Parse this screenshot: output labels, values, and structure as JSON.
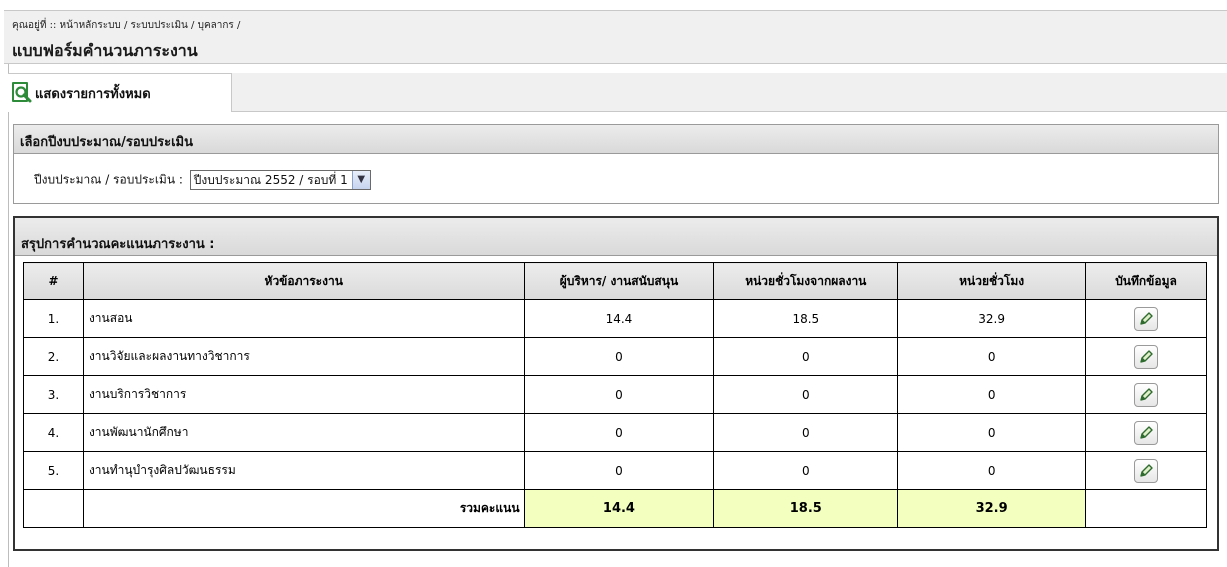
{
  "header": {
    "breadcrumb": "คุณอยู่ที่ :: หน้าหลักระบบ / ระบบประเมิน / บุคลากร /",
    "title": "แบบฟอร์มคำนวนภาระงาน"
  },
  "tabs": [
    {
      "label": "แสดงรายการทั้งหมด",
      "icon": "magnifier-document-icon"
    }
  ],
  "budget_panel": {
    "heading": "เลือกปีงบประมาณ/รอบประเมิน",
    "field_label": "ปีงบประมาณ / รอบประเมิน :",
    "selected": "ปีงบประมาณ 2552 / รอบที่ 1"
  },
  "summary_panel": {
    "heading": "สรุปการคำนวณคะแนนภาระงาน :",
    "columns": [
      "#",
      "หัวข้อภาระงาน",
      "ผู้บริหาร/ งานสนับสนุน",
      "หน่วยชั่วโมงจากผลงาน",
      "หน่วยชั่วโมง",
      "บันทึกข้อมูล"
    ],
    "rows": [
      {
        "num": "1.",
        "topic": "งานสอน",
        "admin": "14.4",
        "work_hours": "18.5",
        "hours": "32.9"
      },
      {
        "num": "2.",
        "topic": "งานวิจัยและผลงานทางวิชาการ",
        "admin": "0",
        "work_hours": "0",
        "hours": "0"
      },
      {
        "num": "3.",
        "topic": "งานบริการวิชาการ",
        "admin": "0",
        "work_hours": "0",
        "hours": "0"
      },
      {
        "num": "4.",
        "topic": "งานพัฒนานักศึกษา",
        "admin": "0",
        "work_hours": "0",
        "hours": "0"
      },
      {
        "num": "5.",
        "topic": "งานทำนุบำรุงศิลปวัฒนธรรม",
        "admin": "0",
        "work_hours": "0",
        "hours": "0"
      }
    ],
    "total": {
      "label": "รวมคะแนน",
      "admin": "14.4",
      "work_hours": "18.5",
      "hours": "32.9"
    },
    "edit_icon": "pencil-icon",
    "total_highlight_color": "#f2ffbf"
  }
}
